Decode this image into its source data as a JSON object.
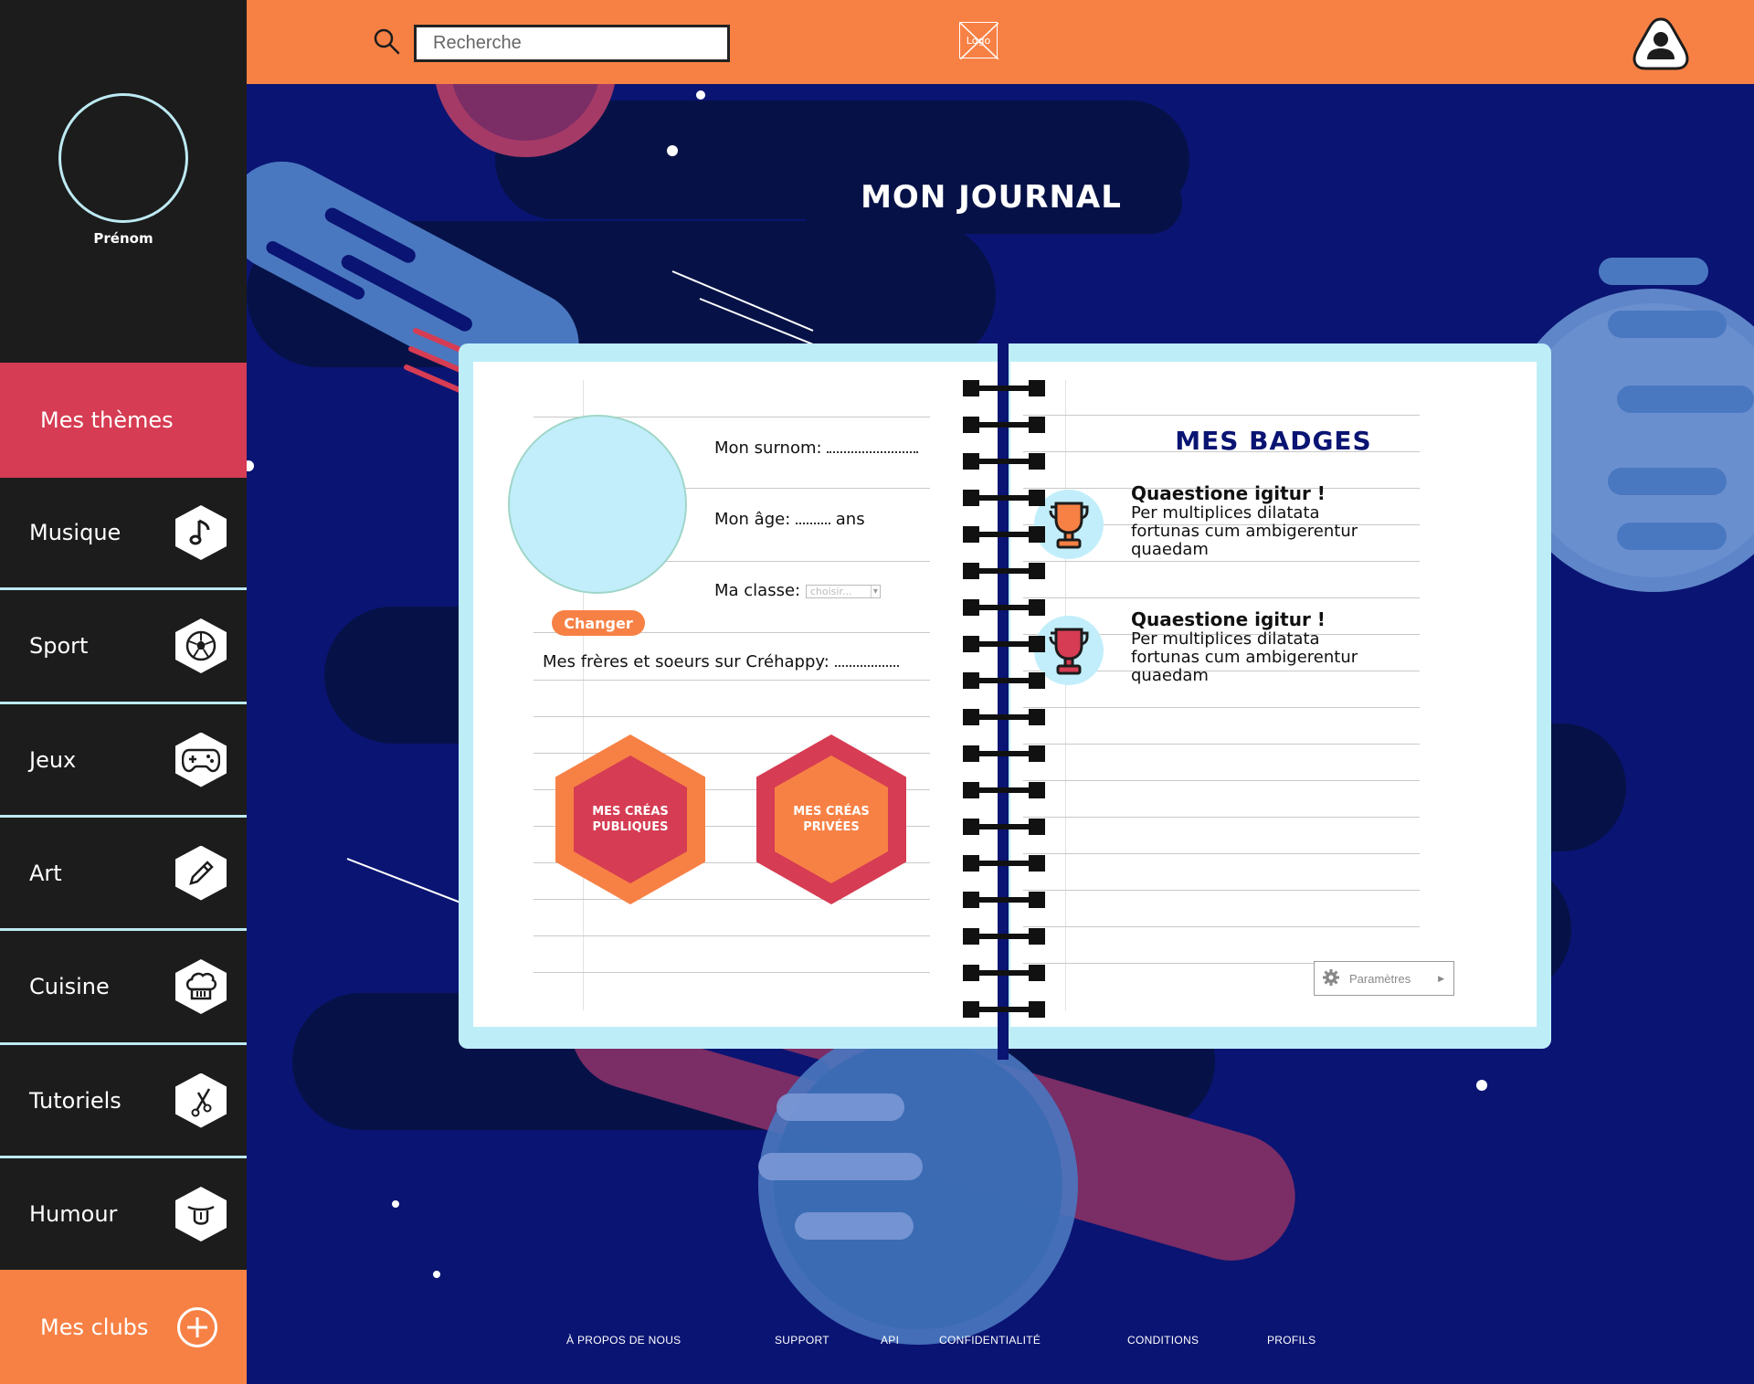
{
  "sidebar": {
    "user_name": "Prénom",
    "themes_label": "Mes thèmes",
    "items": [
      {
        "label": "Musique",
        "icon": "music-note-icon"
      },
      {
        "label": "Sport",
        "icon": "soccer-ball-icon"
      },
      {
        "label": "Jeux",
        "icon": "gamepad-icon"
      },
      {
        "label": "Art",
        "icon": "pencil-icon"
      },
      {
        "label": "Cuisine",
        "icon": "chef-hat-icon"
      },
      {
        "label": "Tutoriels",
        "icon": "tools-icon"
      },
      {
        "label": "Humour",
        "icon": "tongue-face-icon"
      }
    ],
    "clubs_label": "Mes clubs"
  },
  "header": {
    "search_placeholder": "Recherche",
    "logo_text": "Logo"
  },
  "journal": {
    "title": "MON JOURNAL",
    "nickname_label": "Mon surnom:",
    "age_label": "Mon âge:",
    "age_unit": "ans",
    "class_label": "Ma classe:",
    "class_select_value": "choisir...",
    "change_button": "Changer",
    "siblings_label": "Mes frères et soeurs sur Créhappy:",
    "public_creations_line1": "MES CRÉAS",
    "public_creations_line2": "PUBLIQUES",
    "private_creations_line1": "MES CRÉAS",
    "private_creations_line2": "PRIVÉES",
    "badges_title": "MES BADGES",
    "badges": [
      {
        "title": "Quaestione igitur !",
        "text": "Per multiplices dilatata fortunas cum ambigerentur quaedam",
        "icon": "orange-trophy-icon"
      },
      {
        "title": "Quaestione igitur !",
        "text": "Per multiplices dilatata fortunas cum ambigerentur quaedam",
        "icon": "red-trophy-icon"
      }
    ],
    "settings_label": "Paramètres"
  },
  "footer": {
    "links": [
      "À PROPOS DE NOUS",
      "SUPPORT",
      "API",
      "CONFIDENTIALITÉ",
      "CONDITIONS",
      "PROFILS"
    ]
  },
  "colors": {
    "background": "#0a1472",
    "orange": "#f78145",
    "red": "#d63c53",
    "sidebar": "#1c1c1c",
    "light_blue": "#bdeef8"
  }
}
